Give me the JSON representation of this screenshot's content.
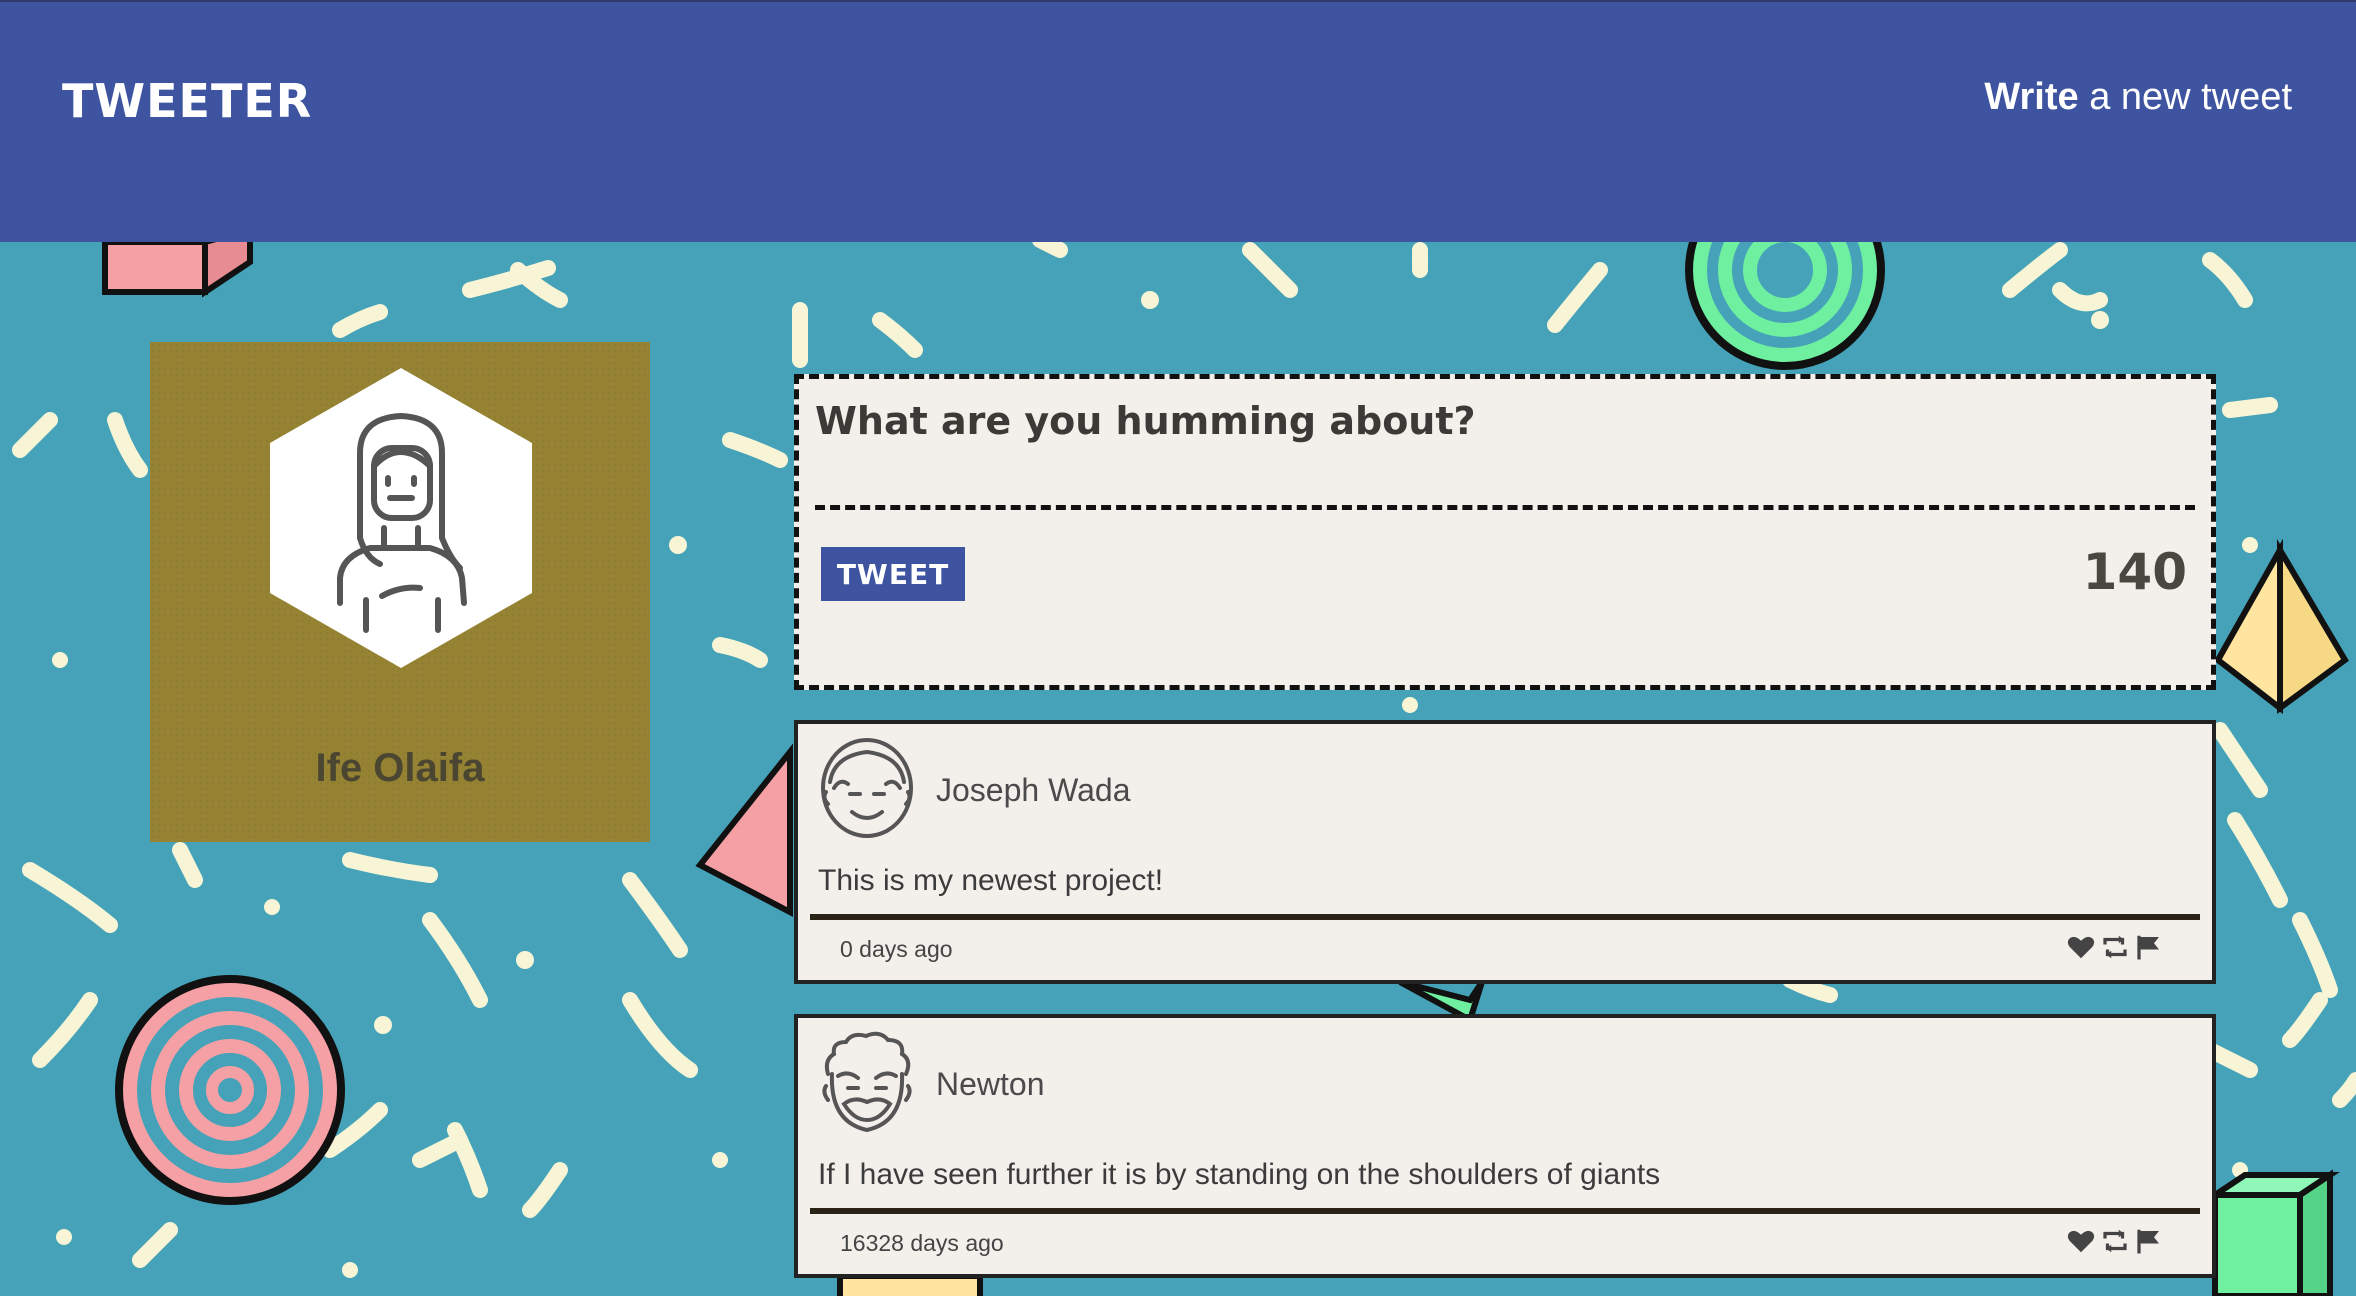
{
  "nav": {
    "brand": "TWEETER",
    "compose_bold": "Write",
    "compose_rest": " a new tweet"
  },
  "profile": {
    "name": "Ife Olaifa",
    "avatar_icon": "woman-avatar-icon"
  },
  "composer": {
    "placeholder": "What are you humming about?",
    "button_label": "TWEET",
    "counter": "140"
  },
  "tweets": [
    {
      "author": "Joseph Wada",
      "content": "This is my newest project!",
      "time": "0 days ago",
      "avatar_icon": "man-avatar-icon"
    },
    {
      "author": "Newton",
      "content": "If I have seen further it is by standing on the shoulders of giants",
      "time": "16328 days ago",
      "avatar_icon": "curly-hair-man-avatar-icon"
    }
  ],
  "action_icons": [
    "heart-icon",
    "retweet-icon",
    "flag-icon"
  ],
  "colors": {
    "nav": "#3e54a0",
    "background": "#45a2b8",
    "profile_card": "#958333",
    "card": "#f3f0eb",
    "button": "#3e54a0"
  }
}
